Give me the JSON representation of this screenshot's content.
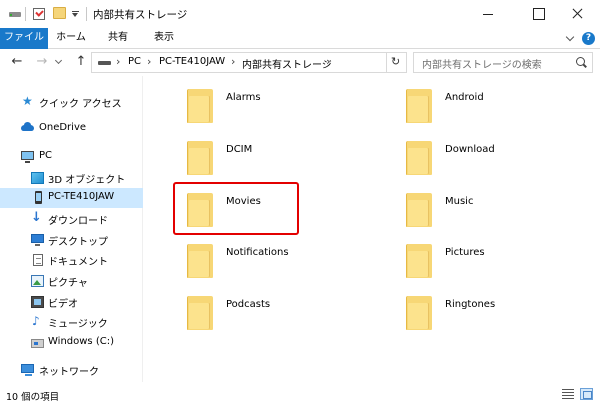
{
  "window": {
    "title": "内部共有ストレージ"
  },
  "ribbon": {
    "tabs": [
      "ファイル",
      "ホーム",
      "共有",
      "表示"
    ],
    "help_icon": "?"
  },
  "address": {
    "crumbs": [
      "PC",
      "PC-TE410JAW",
      "内部共有ストレージ"
    ],
    "search_placeholder": "内部共有ストレージの検索"
  },
  "sidebar": {
    "items": [
      {
        "label": "クイック アクセス",
        "icon": "star-icon"
      },
      {
        "label": "OneDrive",
        "icon": "cloud-icon"
      },
      {
        "label": "PC",
        "icon": "computer-icon"
      },
      {
        "label": "3D オブジェクト",
        "icon": "3d-objects-icon"
      },
      {
        "label": "PC-TE410JAW",
        "icon": "phone-icon",
        "selected": true
      },
      {
        "label": "ダウンロード",
        "icon": "download-icon"
      },
      {
        "label": "デスクトップ",
        "icon": "desktop-icon"
      },
      {
        "label": "ドキュメント",
        "icon": "document-icon"
      },
      {
        "label": "ピクチャ",
        "icon": "pictures-icon"
      },
      {
        "label": "ビデオ",
        "icon": "video-icon"
      },
      {
        "label": "ミュージック",
        "icon": "music-icon"
      },
      {
        "label": "Windows (C:)",
        "icon": "drive-icon"
      },
      {
        "label": "ネットワーク",
        "icon": "network-icon"
      }
    ]
  },
  "folders": [
    {
      "name": "Alarms"
    },
    {
      "name": "Android"
    },
    {
      "name": "DCIM"
    },
    {
      "name": "Download"
    },
    {
      "name": "Movies",
      "highlighted": true
    },
    {
      "name": "Music"
    },
    {
      "name": "Notifications"
    },
    {
      "name": "Pictures"
    },
    {
      "name": "Podcasts"
    },
    {
      "name": "Ringtones"
    }
  ],
  "status": {
    "item_count": "10 個の項目"
  },
  "colors": {
    "file_tab": "#1979ca",
    "selection": "#cce8ff",
    "highlight_box": "#e30000",
    "folder": "#f7d776"
  }
}
